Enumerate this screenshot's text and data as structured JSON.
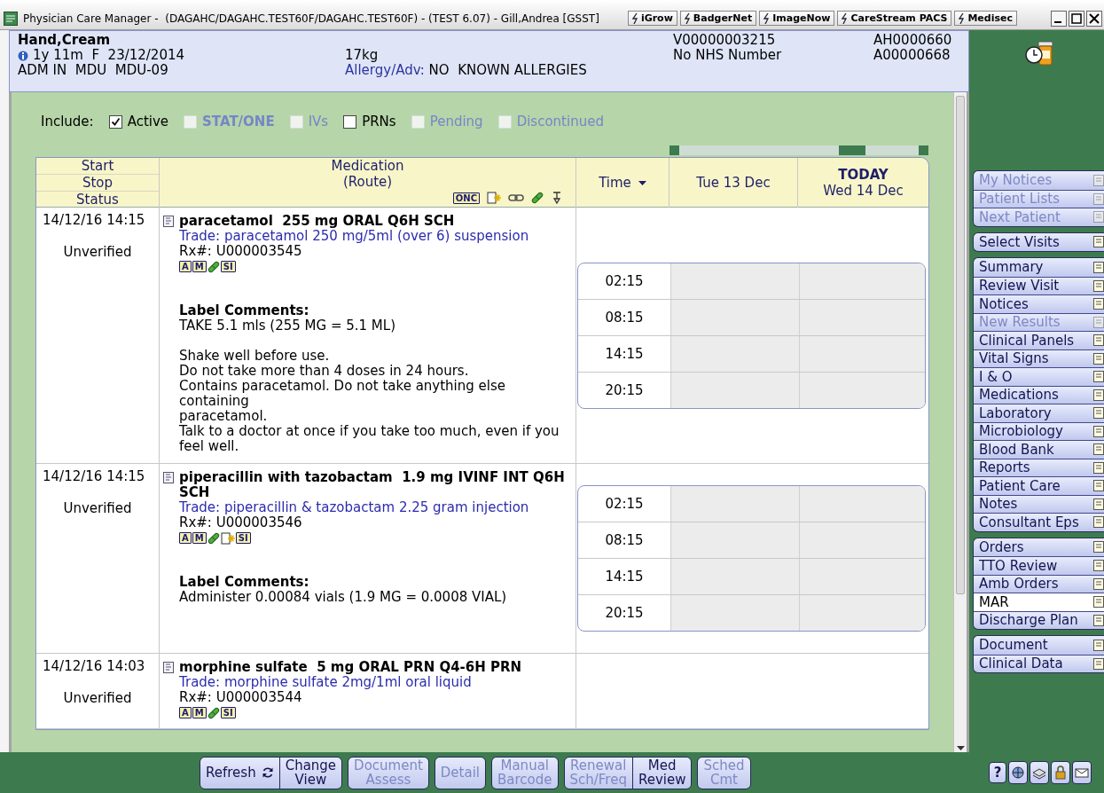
{
  "window": {
    "title": "Physician Care Manager -  (DAGAHC/DAGAHC.TEST60F/DAGAHC.TEST60F) - (TEST 6.07) - Gill,Andrea [GSST]",
    "links": [
      "iGrow",
      "BadgerNet",
      "ImageNow",
      "CareStream PACS",
      "Medisec"
    ]
  },
  "patient": {
    "name": "Hand,Cream",
    "age_sex_dob": "1y 11m  F  23/12/2014",
    "location": "ADM IN  MDU  MDU-09",
    "weight": "17kg",
    "allergy_label": "Allergy/Adv:",
    "allergy_value": "NO  KNOWN ALLERGIES",
    "visit_number": "V00000003215",
    "nhs_number": "No NHS Number",
    "id_1": "AH0000660",
    "id_2": "A00000668"
  },
  "filters": {
    "label": "Include:",
    "options": [
      {
        "label": "Active",
        "checked": true,
        "disabled": false,
        "bold": false
      },
      {
        "label": "STAT/ONE",
        "checked": false,
        "disabled": true,
        "bold": true
      },
      {
        "label": "IVs",
        "checked": false,
        "disabled": true,
        "bold": false
      },
      {
        "label": "PRNs",
        "checked": false,
        "disabled": false,
        "bold": false
      },
      {
        "label": "Pending",
        "checked": false,
        "disabled": true,
        "bold": false
      },
      {
        "label": "Discontinued",
        "checked": false,
        "disabled": true,
        "bold": false
      }
    ]
  },
  "table": {
    "columns": {
      "start": "Start",
      "stop": "Stop",
      "status": "Status",
      "medication": "Medication",
      "route": "(Route)",
      "time": "Time",
      "day_1": "Tue 13 Dec",
      "today_label": "TODAY",
      "today_date": "Wed 14 Dec"
    },
    "header_icons": [
      {
        "kind": "badge",
        "text": "ONC"
      },
      {
        "kind": "note"
      },
      {
        "kind": "link"
      },
      {
        "kind": "pill"
      },
      {
        "kind": "pin"
      }
    ],
    "rows": [
      {
        "start": "14/12/16 14:15",
        "status": "Unverified",
        "name": "paracetamol  255 mg ORAL Q6H SCH",
        "trade": "Trade: paracetamol 250 mg/5ml (over 6) suspension",
        "rx": "Rx#: U000003545",
        "icons": [
          {
            "kind": "badge",
            "text": "A"
          },
          {
            "kind": "badge",
            "text": "M"
          },
          {
            "kind": "pill"
          },
          {
            "kind": "badge",
            "text": "SI"
          }
        ],
        "comments_title": "Label Comments:",
        "comments": [
          [
            "TAKE 5.1 mls (255 MG = 5.1 ML)"
          ],
          [
            "Shake well before use.",
            "Do not take more than 4 doses in 24 hours.",
            "Contains paracetamol. Do not take anything else containing",
            "paracetamol.",
            "Talk to a doctor at once if you take too much, even if you",
            "feel well."
          ]
        ],
        "times": [
          "02:15",
          "08:15",
          "14:15",
          "20:15"
        ]
      },
      {
        "start": "14/12/16 14:15",
        "status": "Unverified",
        "name": "piperacillin with tazobactam  1.9 mg IVINF INT Q6H SCH",
        "trade": "Trade: piperacillin & tazobactam 2.25 gram injection",
        "rx": "Rx#: U000003546",
        "icons": [
          {
            "kind": "badge",
            "text": "A"
          },
          {
            "kind": "badge",
            "text": "M"
          },
          {
            "kind": "pill"
          },
          {
            "kind": "note"
          },
          {
            "kind": "badge",
            "text": "SI"
          }
        ],
        "comments_title": "Label Comments:",
        "comments": [
          [
            "Administer 0.00084 vials (1.9 MG = 0.0008 VIAL)"
          ]
        ],
        "times": [
          "02:15",
          "08:15",
          "14:15",
          "20:15"
        ]
      },
      {
        "start": "14/12/16 14:03",
        "status": "Unverified",
        "name": "morphine sulfate  5 mg ORAL PRN Q4-6H PRN",
        "trade": "Trade: morphine sulfate 2mg/1ml oral liquid",
        "rx": "Rx#: U000003544",
        "icons": [
          {
            "kind": "badge",
            "text": "A"
          },
          {
            "kind": "badge",
            "text": "M"
          },
          {
            "kind": "pill"
          },
          {
            "kind": "badge",
            "text": "SI"
          }
        ]
      }
    ]
  },
  "sidebar": {
    "groups": [
      {
        "items": [
          {
            "label": "My Notices",
            "disabled": true,
            "selected": false
          },
          {
            "label": "Patient Lists",
            "disabled": true,
            "selected": false
          },
          {
            "label": "Next Patient",
            "disabled": true,
            "selected": false
          }
        ]
      },
      {
        "items": [
          {
            "label": "Select Visits",
            "disabled": false,
            "selected": false
          }
        ]
      },
      {
        "items": [
          {
            "label": "Summary",
            "disabled": false,
            "selected": false
          },
          {
            "label": "Review Visit",
            "disabled": false,
            "selected": false
          },
          {
            "label": "Notices",
            "disabled": false,
            "selected": false
          },
          {
            "label": "New Results",
            "disabled": true,
            "selected": false
          },
          {
            "label": "Clinical Panels",
            "disabled": false,
            "selected": false
          },
          {
            "label": "Vital Signs",
            "disabled": false,
            "selected": false
          },
          {
            "label": "I & O",
            "disabled": false,
            "selected": false
          },
          {
            "label": "Medications",
            "disabled": false,
            "selected": false
          },
          {
            "label": "Laboratory",
            "disabled": false,
            "selected": false
          },
          {
            "label": "Microbiology",
            "disabled": false,
            "selected": false
          },
          {
            "label": "Blood Bank",
            "disabled": false,
            "selected": false
          },
          {
            "label": "Reports",
            "disabled": false,
            "selected": false
          },
          {
            "label": "Patient Care",
            "disabled": false,
            "selected": false
          },
          {
            "label": "Notes",
            "disabled": false,
            "selected": false
          },
          {
            "label": "Consultant Eps",
            "disabled": false,
            "selected": false
          }
        ]
      },
      {
        "items": [
          {
            "label": "Orders",
            "disabled": false,
            "selected": false
          },
          {
            "label": "TTO Review",
            "disabled": false,
            "selected": false
          },
          {
            "label": "Amb Orders",
            "disabled": false,
            "selected": false
          },
          {
            "label": "MAR",
            "disabled": false,
            "selected": true
          },
          {
            "label": "Discharge Plan",
            "disabled": false,
            "selected": false
          }
        ]
      },
      {
        "items": [
          {
            "label": "Document",
            "disabled": false,
            "selected": false
          },
          {
            "label": "Clinical Data",
            "disabled": false,
            "selected": false
          }
        ]
      }
    ]
  },
  "actions": {
    "groups": [
      {
        "buttons": [
          {
            "label": "Refresh",
            "kind": "refresh",
            "disabled": false
          },
          {
            "label": "Change View",
            "kind": "plain",
            "disabled": false
          }
        ]
      },
      {
        "buttons": [
          {
            "label": "Document Assess",
            "kind": "plain",
            "disabled": true
          }
        ]
      },
      {
        "buttons": [
          {
            "label": "Detail",
            "kind": "plain",
            "disabled": true
          }
        ]
      },
      {
        "buttons": [
          {
            "label": "Manual Barcode",
            "kind": "plain",
            "disabled": true
          }
        ]
      },
      {
        "buttons": [
          {
            "label": "Renewal Sch/Freq",
            "kind": "plain",
            "disabled": true
          },
          {
            "label": "Med Review",
            "kind": "plain",
            "disabled": false
          }
        ]
      },
      {
        "buttons": [
          {
            "label": "Sched Cmt",
            "kind": "plain",
            "disabled": true
          }
        ]
      }
    ],
    "help": "?"
  }
}
